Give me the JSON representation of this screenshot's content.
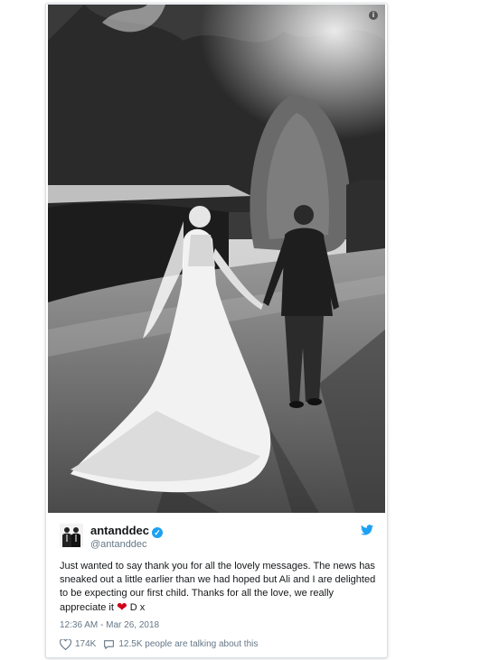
{
  "tweet": {
    "display_name": "antanddec",
    "handle": "@antanddec",
    "text_before_emoji": "Just wanted to say thank you for all the lovely messages. The news has sneaked out a little earlier than we had hoped but Ali and I are delighted to be expecting our first child. Thanks for all the love, we really appreciate it",
    "emoji": "❤",
    "text_after_emoji": " D x",
    "timestamp": "12:36 AM - Mar 26, 2018",
    "likes": "174K",
    "talking": "12.5K people are talking about this"
  },
  "icons": {
    "info": "info-icon",
    "verified": "verified-badge-icon",
    "brand": "twitter-bird-icon",
    "like": "heart-icon",
    "reply": "speech-bubble-icon"
  },
  "colors": {
    "verified": "#1da1f2",
    "brand": "#1da1f2",
    "secondary_text": "#657786",
    "emoji_heart": "#d0021b"
  }
}
